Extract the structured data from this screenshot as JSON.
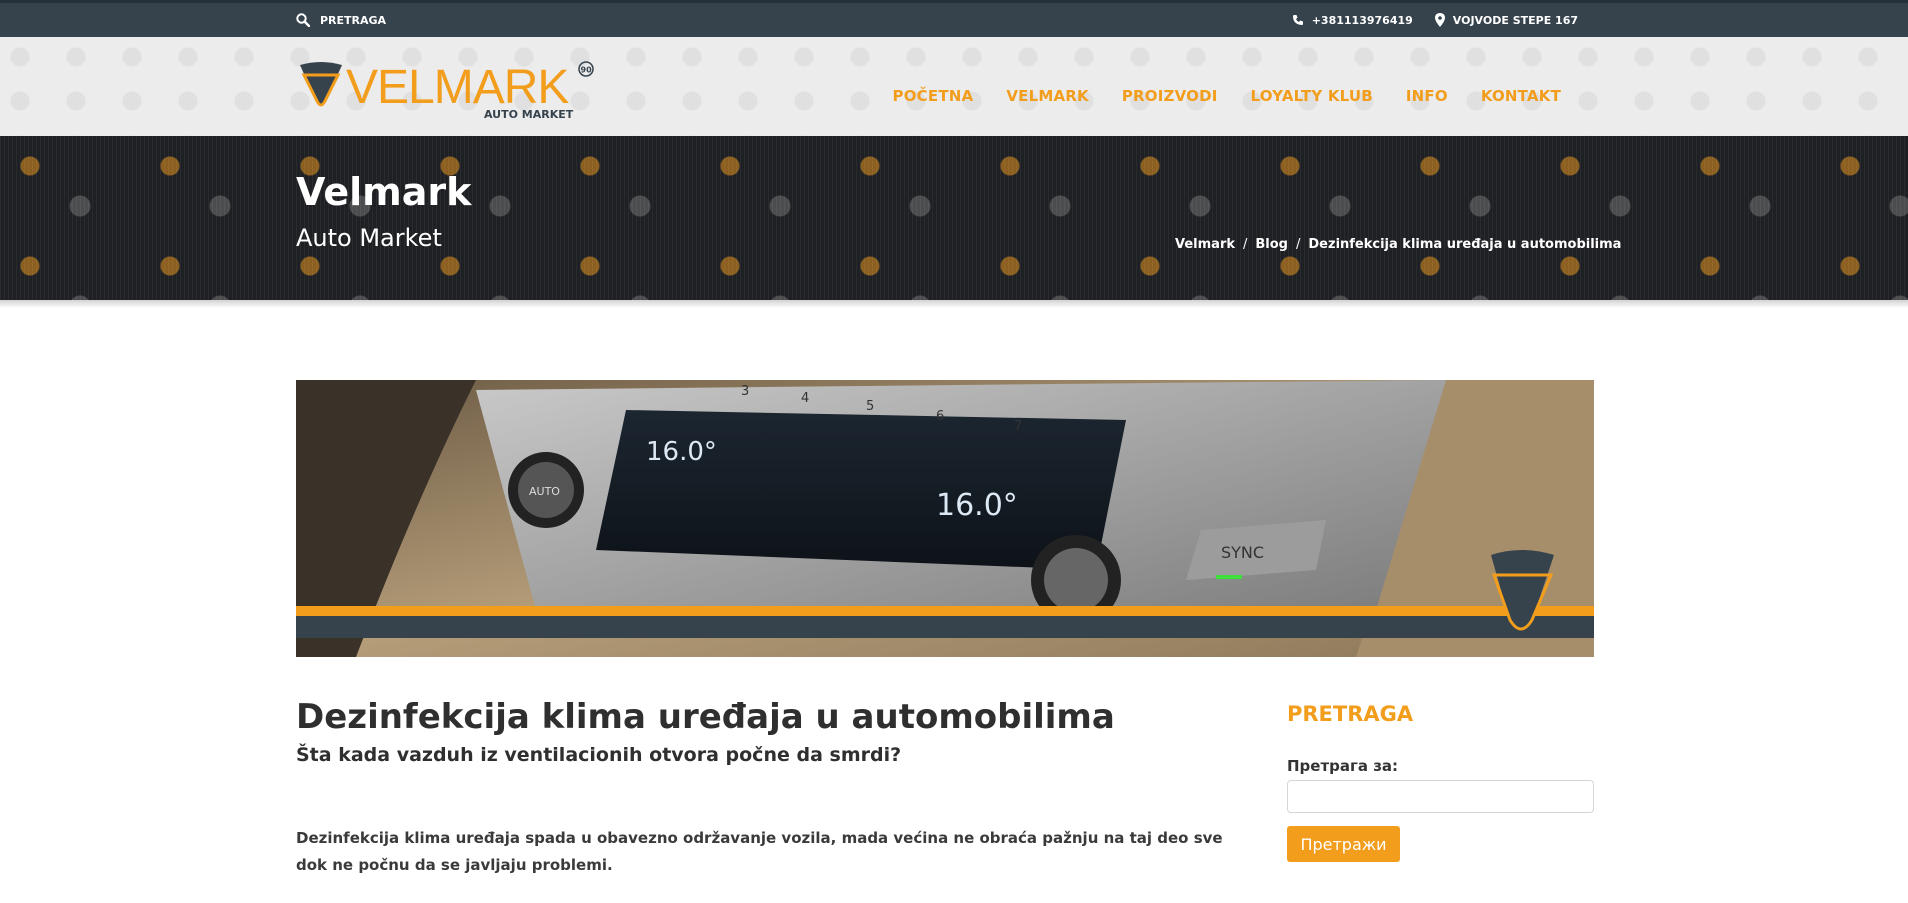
{
  "topbar": {
    "search_label": "PRETRAGA",
    "phone": "+381113976419",
    "address": "VOJVODE STEPE 167"
  },
  "logo": {
    "name": "VELMARK",
    "tagline": "AUTO MARKET",
    "badge": "90"
  },
  "nav": {
    "items": [
      {
        "label": "POČETNA"
      },
      {
        "label": "VELMARK"
      },
      {
        "label": "PROIZVODI"
      },
      {
        "label": "LOYALTY KLUB"
      },
      {
        "label": "INFO"
      },
      {
        "label": "KONTAKT"
      }
    ]
  },
  "banner": {
    "title": "Velmark",
    "subtitle": "Auto Market",
    "breadcrumb": [
      "Velmark",
      "Blog",
      "Dezinfekcija klima uređaja u automobilima"
    ],
    "separator": "/"
  },
  "hero": {
    "left_temp": "16.0°",
    "right_temp": "16.0°",
    "knob_label": "AUTO",
    "button_label": "SYNC",
    "fan_labels": [
      "3",
      "4",
      "5",
      "6",
      "7"
    ]
  },
  "article": {
    "title": "Dezinfekcija klima uređaja u automobilima",
    "subtitle": "Šta kada vazduh iz ventilacionih otvora počne da smrdi?",
    "text": "Dezinfekcija klima uređaja spada u obavezno održavanje vozila, mada većina ne obraća pažnju na taj deo sve dok ne počnu da se javljaju problemi."
  },
  "sidebar": {
    "widget_title": "PRETRAGA",
    "search_label": "Претрага за:",
    "search_value": "",
    "search_button": "Претражи"
  },
  "colors": {
    "accent": "#f29d1c",
    "topbar": "#36434d",
    "banner": "#1f2024"
  }
}
